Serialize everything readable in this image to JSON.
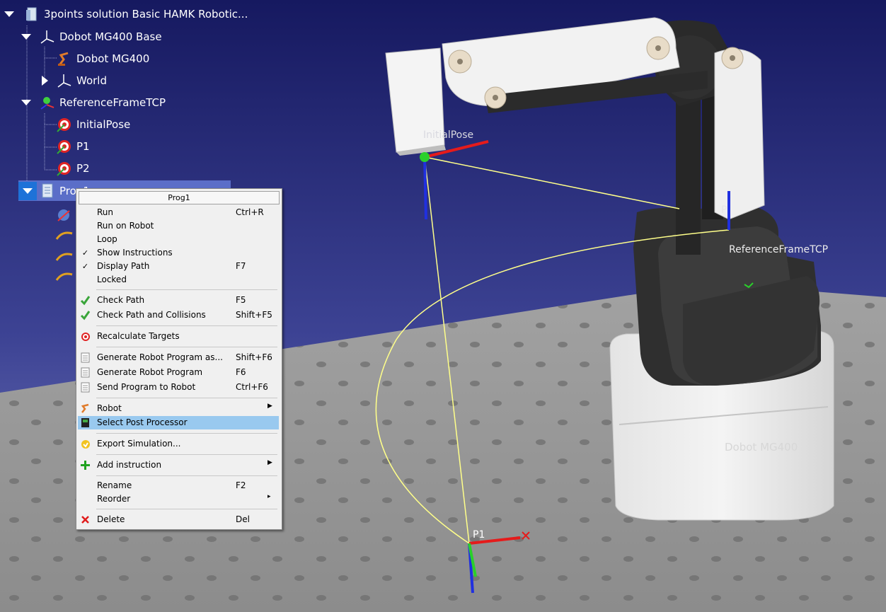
{
  "tree": {
    "root": "3points solution Basic HAMK Robotic...",
    "base": "Dobot MG400 Base",
    "robot": "Dobot MG400",
    "world": "World",
    "ref_frame": "ReferenceFrameTCP",
    "targets": [
      "InitialPose",
      "P1",
      "P2"
    ],
    "program": "Prog1"
  },
  "context_menu": {
    "title": "Prog1",
    "items": [
      {
        "label": "Run",
        "shortcut": "Ctrl+R"
      },
      {
        "label": "Run on Robot",
        "shortcut": ""
      },
      {
        "label": "Loop",
        "shortcut": ""
      },
      {
        "label": "Show Instructions",
        "shortcut": "",
        "check": "✓"
      },
      {
        "label": "Display Path",
        "shortcut": "F7",
        "check": "✓"
      },
      {
        "label": "Locked",
        "shortcut": ""
      },
      {
        "label": "Check Path",
        "shortcut": "F5"
      },
      {
        "label": "Check Path and Collisions",
        "shortcut": "Shift+F5"
      },
      {
        "label": "Recalculate Targets",
        "shortcut": ""
      },
      {
        "label": "Generate Robot Program as...",
        "shortcut": "Shift+F6"
      },
      {
        "label": "Generate Robot Program",
        "shortcut": "F6"
      },
      {
        "label": "Send Program to Robot",
        "shortcut": "Ctrl+F6"
      },
      {
        "label": "Robot",
        "shortcut": "",
        "submenu": "▶"
      },
      {
        "label": "Select Post Processor",
        "shortcut": ""
      },
      {
        "label": "Export Simulation...",
        "shortcut": ""
      },
      {
        "label": "Add instruction",
        "shortcut": "",
        "submenu": "▶"
      },
      {
        "label": "Rename",
        "shortcut": "F2"
      },
      {
        "label": "Reorder",
        "shortcut": "",
        "submenu": "▸"
      },
      {
        "label": "Delete",
        "shortcut": "Del"
      }
    ]
  },
  "viewport_labels": {
    "initial_pose": "InitialPose",
    "ref_frame": "ReferenceFrameTCP",
    "robot": "Dobot MG400",
    "p1": "P1",
    "p2_partial": "P"
  },
  "colors": {
    "bg_top": "#1a1d63",
    "bg_bottom": "#6f76b8",
    "table": "#9c9c9c",
    "menu_highlight": "#99c9ef",
    "path": "#ffff8a"
  }
}
